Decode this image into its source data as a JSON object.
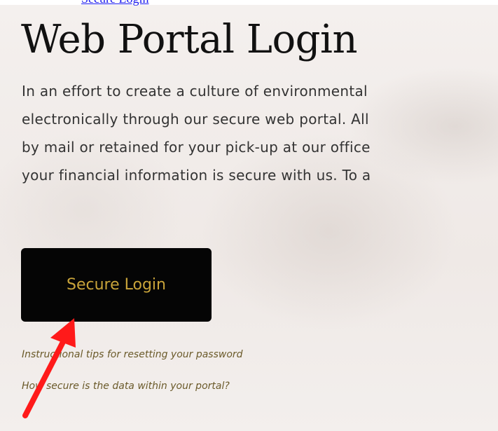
{
  "header": {
    "top_link_text": "Secure Login"
  },
  "main": {
    "title": "Web Portal Login",
    "intro_lines": [
      "In an effort to create a culture of environmental",
      "electronically through our secure web portal. All",
      "by mail or retained for your pick-up at our office",
      "your financial information is secure with us. To a"
    ],
    "login_button_label": "Secure Login",
    "links": {
      "password_tips": "Instructional tips for resetting your password",
      "data_security": "How secure is the data within your portal?"
    }
  },
  "annotation": {
    "arrow_color": "#ff1a1a"
  },
  "colors": {
    "title": "#111111",
    "body_text": "#333333",
    "button_bg": "#050505",
    "button_text": "#c9a43a",
    "link_text": "#6b5a2a",
    "top_link": "#1a1aee"
  }
}
